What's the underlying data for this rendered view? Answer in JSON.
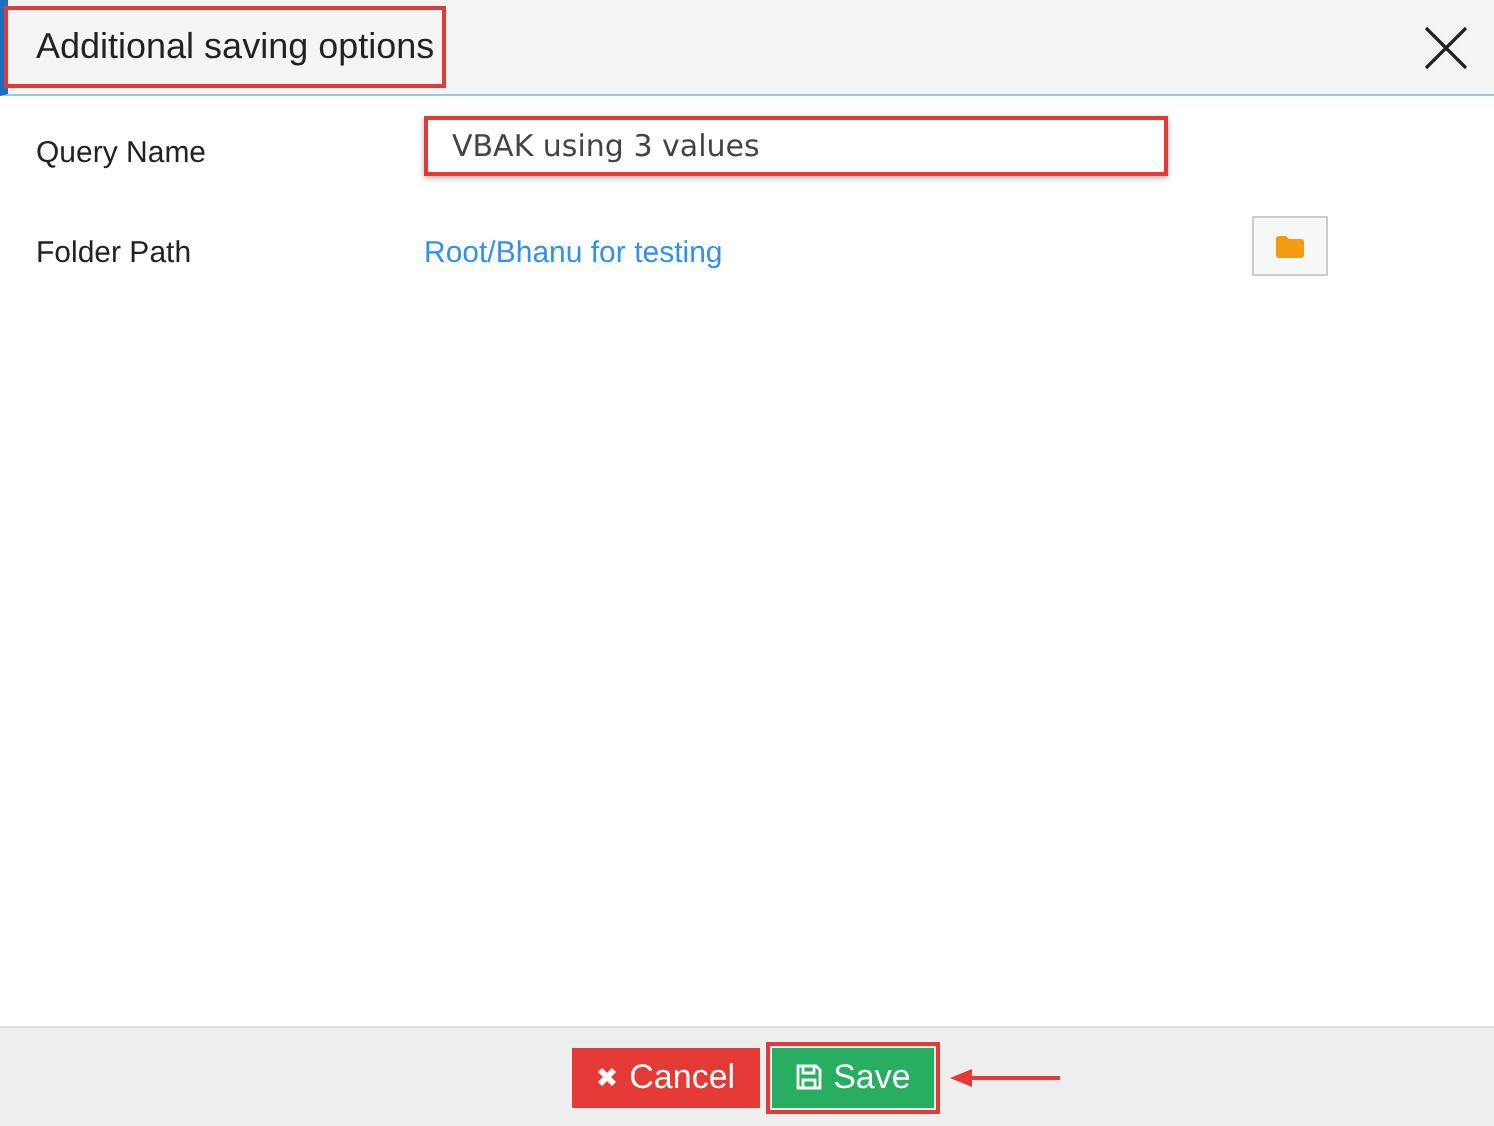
{
  "dialog": {
    "title": "Additional saving options"
  },
  "fields": [
    {
      "kind": "input",
      "label": "Query Name",
      "value": "VBAK using 3 values"
    },
    {
      "kind": "link",
      "label": "Folder Path",
      "value": "Root/Bhanu for testing"
    }
  ],
  "buttons": [
    {
      "kind": "cancel",
      "label": "Cancel"
    },
    {
      "kind": "save",
      "label": "Save"
    }
  ]
}
